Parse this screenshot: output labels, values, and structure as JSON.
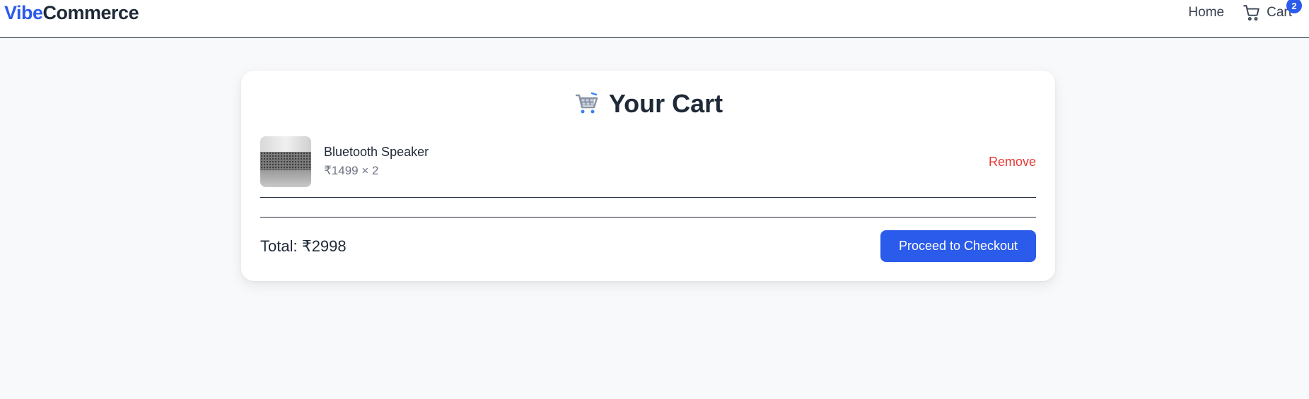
{
  "header": {
    "brand_part1": "Vibe",
    "brand_part2": "Commerce",
    "nav_home": "Home",
    "nav_cart": "Cart",
    "cart_count": "2",
    "cart_icon": "shopping-cart-icon"
  },
  "cart": {
    "title": "Your Cart",
    "title_icon": "shopping-cart-emoji",
    "items": [
      {
        "name": "Bluetooth Speaker",
        "price_line": "₹1499 × 2",
        "remove_label": "Remove",
        "image": "bluetooth-speaker-thumbnail"
      }
    ],
    "total_label": "Total: ₹2998",
    "checkout_label": "Proceed to Checkout"
  },
  "colors": {
    "accent": "#2b5bea",
    "danger": "#e53935",
    "text": "#1f2937",
    "muted": "#6b7280",
    "background": "#f8f9fb"
  }
}
